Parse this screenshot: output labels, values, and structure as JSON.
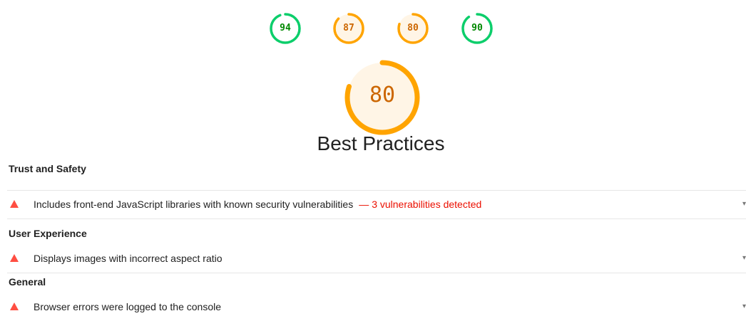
{
  "summary_gauges": [
    {
      "value": "94",
      "score": 0.94,
      "color": "#0cce6b",
      "fill": "#ffffff",
      "text_color": "#008800"
    },
    {
      "value": "87",
      "score": 0.87,
      "color": "#ffa400",
      "fill": "#fff5e6",
      "text_color": "#cc6600"
    },
    {
      "value": "80",
      "score": 0.8,
      "color": "#ffa400",
      "fill": "#fff5e6",
      "text_color": "#cc6600"
    },
    {
      "value": "90",
      "score": 0.9,
      "color": "#0cce6b",
      "fill": "#ffffff",
      "text_color": "#008800"
    }
  ],
  "category": {
    "score_label": "80",
    "score": 0.8,
    "title": "Best Practices",
    "color": "#ffa400",
    "fill": "#fff5e6",
    "text_color": "#cc6600"
  },
  "groups": [
    {
      "title": "Trust and Safety",
      "audits": [
        {
          "title": "Includes front-end JavaScript libraries with known security vulnerabilities",
          "separator": "—",
          "display_value": "3 vulnerabilities detected",
          "icon": "fail-triangle-icon"
        }
      ]
    },
    {
      "title": "User Experience",
      "audits": [
        {
          "title": "Displays images with incorrect aspect ratio",
          "icon": "fail-triangle-icon"
        }
      ]
    },
    {
      "title": "General",
      "audits": [
        {
          "title": "Browser errors were logged to the console",
          "icon": "fail-triangle-icon"
        }
      ]
    }
  ],
  "colors": {
    "fail": "#ff4e42",
    "fail_text": "#eb0f00",
    "pass": "#0cce6b",
    "average": "#ffa400"
  }
}
